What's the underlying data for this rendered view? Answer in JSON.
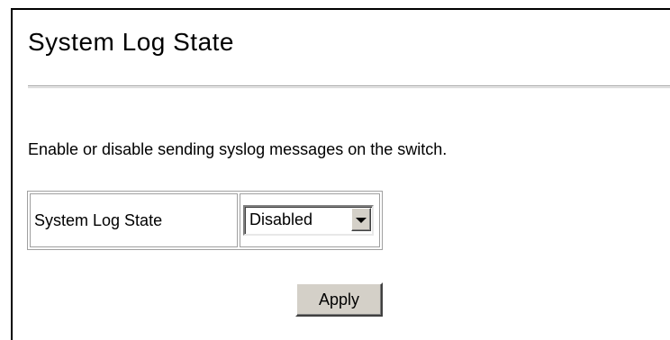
{
  "page": {
    "title": "System Log State",
    "description": "Enable or disable sending syslog messages on the switch."
  },
  "form": {
    "field_label": "System Log State",
    "select_value": "Disabled",
    "select_options": [
      "Disabled"
    ],
    "apply_label": "Apply"
  },
  "icons": {
    "dropdown": "chevron-down-icon"
  }
}
